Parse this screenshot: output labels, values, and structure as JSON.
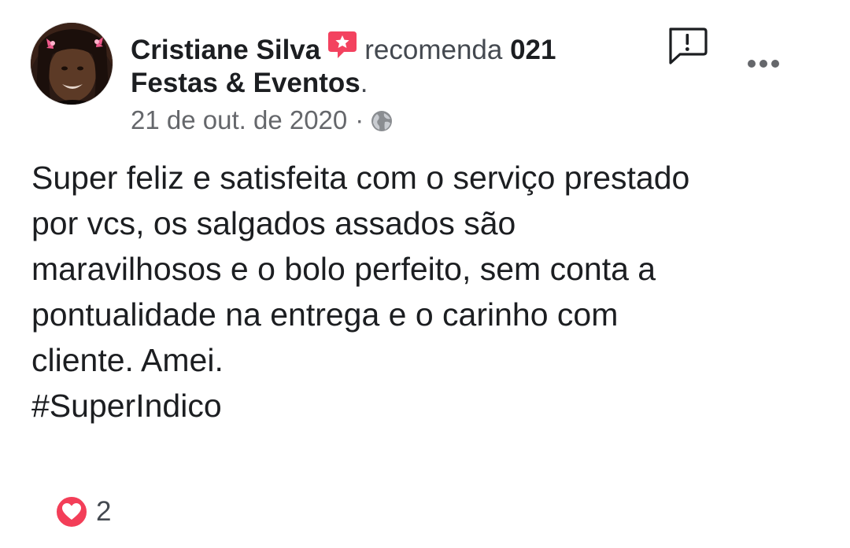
{
  "post": {
    "author": "Cristiane Silva",
    "action": "recomenda",
    "page_name_part1": "021",
    "page_name_part2": "Festas & Eventos",
    "page_name_suffix": ".",
    "date": "21 de out. de 2020",
    "separator": "·",
    "privacy_icon": "globe-icon",
    "recommend_icon": "recommend-star-bubble-icon",
    "body_text": "Super feliz e satisfeita com o serviço prestado\npor vcs, os salgados assados são\nmaravilhosos e o bolo perfeito, sem conta a\npontualidade na entrega e o carinho com\ncliente. Amei.",
    "hashtag": "#SuperIndico",
    "reaction_icon": "love-icon",
    "reaction_count": "2"
  },
  "actions": {
    "report_icon": "report-exclamation-icon",
    "more_icon": "more-options-icon"
  },
  "colors": {
    "recommend_red": "#f3425f",
    "love_red": "#f33e58",
    "text_primary": "#1c1e21",
    "text_secondary": "#65676b"
  }
}
